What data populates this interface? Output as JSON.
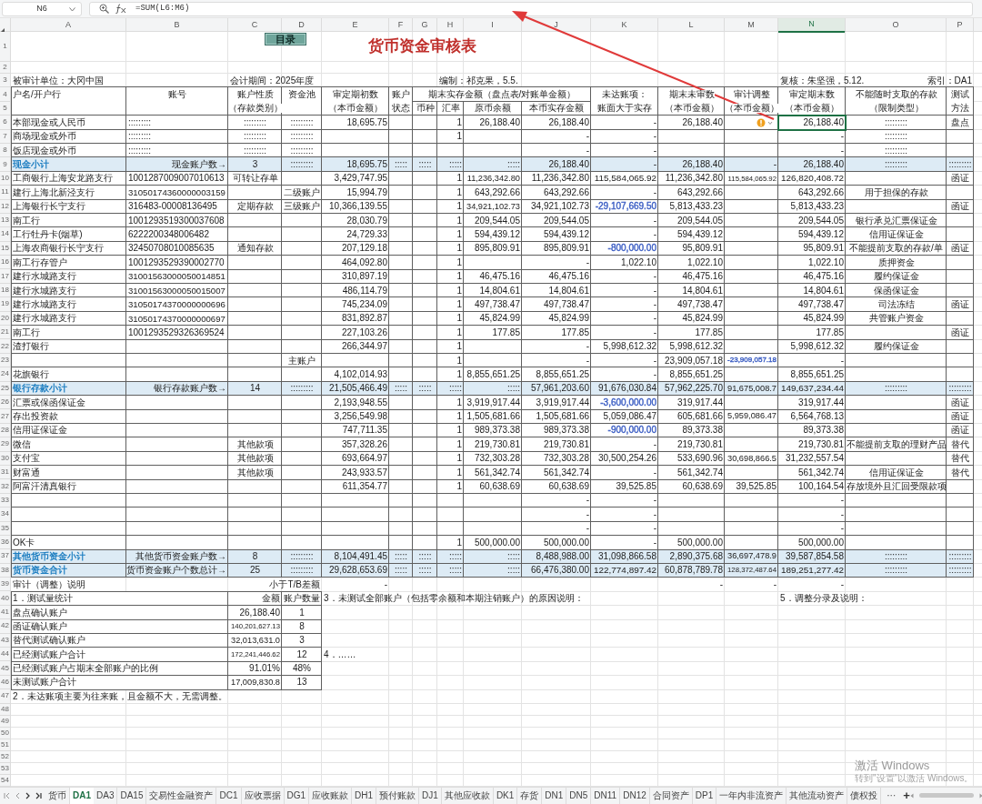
{
  "formula_bar": {
    "name_box": "N6",
    "formula": "=SUM(L6:M6)"
  },
  "columns": [
    "A",
    "B",
    "C",
    "D",
    "E",
    "F",
    "G",
    "H",
    "I",
    "J",
    "K",
    "L",
    "M",
    "N",
    "O",
    "P"
  ],
  "rows": [
    {
      "num": "1",
      "kind": "title",
      "toc_button": "目录",
      "title": "货币资金审核表"
    },
    {
      "num": "2",
      "kind": "empty"
    },
    {
      "num": "3",
      "kind": "info",
      "unit": "被审计单位：大冈中国",
      "period": "会计期间：2025年度",
      "preparer": "编制：祁克果，5.5.",
      "reviewer": "复核：朱坚强，5.12.",
      "index": "索引：DA1"
    },
    {
      "num": "4",
      "kind": "header",
      "cells": {
        "A": "户名/开户行",
        "B": "账号",
        "C": "账户性质",
        "D": "资金池",
        "E": "审定期初数",
        "F": "账户",
        "G": "期末实存金额（盘点表/对账单金额）",
        "K": "未达账项：",
        "L": "期末未审数",
        "M": "审计调整",
        "N": "审定期末数",
        "O": "不能随时支取的存款",
        "P": "测试"
      }
    },
    {
      "num": "5",
      "kind": "header",
      "cells": {
        "C": "（存款类别）",
        "E": "（本币金额）",
        "F": "状态",
        "G": "币种",
        "H": "汇率",
        "I": "原币余额",
        "J": "本币实存金额",
        "K": "账面大于实存",
        "L": "（本币金额）",
        "M": "（本币金额）",
        "N": "（本币金额）",
        "O": "（限制类型）",
        "P": "方法"
      }
    },
    {
      "num": "6",
      "kind": "row",
      "cells": {
        "A": "本部现金或人民币",
        "B": ":::::::::",
        "C": ":::::::::",
        "D": ":::::::::",
        "E": "18,695.75",
        "H": "1",
        "I": "26,188.40",
        "J": "26,188.40",
        "K": "-",
        "L": "26,188.40",
        "M": {
          "flagged": true
        },
        "N": {
          "v": "26,188.40",
          "active": true
        },
        "O": ":::::::::",
        "P": "盘点"
      }
    },
    {
      "num": "7",
      "kind": "row",
      "cells": {
        "A": "商场现金或外币",
        "B": ":::::::::",
        "C": ":::::::::",
        "D": ":::::::::",
        "H": "1",
        "J": "-",
        "K": "-",
        "N": "-",
        "O": ":::::::::"
      }
    },
    {
      "num": "8",
      "kind": "row",
      "cells": {
        "A": "饭店现金或外币",
        "B": ":::::::::",
        "C": ":::::::::",
        "D": ":::::::::",
        "J": "-",
        "K": "-",
        "N": "-",
        "O": ":::::::::"
      }
    },
    {
      "num": "9",
      "kind": "subtotal",
      "cells": {
        "A": "现金小计",
        "B": "现金账户数→",
        "C": "3",
        "D": ":::::::::",
        "E": "18,695.75",
        "F": ":::::",
        "G": ":::::",
        "H": ":::::",
        "I": ":::::",
        "J": "26,188.40",
        "K": "-",
        "L": "26,188.40",
        "M": "-",
        "N": "26,188.40",
        "O": ":::::::::",
        "P": ":::::::::"
      }
    },
    {
      "num": "10",
      "kind": "row",
      "cells": {
        "A": "工商银行上海安龙路支行",
        "B": "1001287009007010613",
        "C": "可转让存单",
        "E": "3,429,747.95",
        "H": "1",
        "I": "11,236,342.80",
        "J": "11,236,342.80",
        "K": "115,584,065.92",
        "L": "11,236,342.80",
        "M": "115,584,065.92",
        "N": "126,820,408.72",
        "P": "函证"
      }
    },
    {
      "num": "11",
      "kind": "row",
      "cells": {
        "A": "建行上海北新泾支行",
        "B": "31050174360000003159",
        "D": "二级账户",
        "E": "15,994.79",
        "H": "1",
        "I": "643,292.66",
        "J": "643,292.66",
        "K": "-",
        "L": "643,292.66",
        "N": "643,292.66",
        "O": "用于担保的存款"
      }
    },
    {
      "num": "12",
      "kind": "row",
      "cells": {
        "A": "上海银行长宁支行",
        "B": "316483-00008136495",
        "C": "定期存款",
        "D": "三级账户",
        "E": "10,366,139.55",
        "H": "1",
        "I": "34,921,102.73",
        "J": "34,921,102.73",
        "K": {
          "v": "-29,107,669.50",
          "color": "#3d5fc4"
        },
        "L": "5,813,433.23",
        "N": "5,813,433.23",
        "P": "函证"
      }
    },
    {
      "num": "13",
      "kind": "row",
      "cells": {
        "A": "南工行",
        "B": "1001293519300037608",
        "E": "28,030.79",
        "H": "1",
        "I": "209,544.05",
        "J": "209,544.05",
        "K": "-",
        "L": "209,544.05",
        "N": "209,544.05",
        "O": "银行承兑汇票保证金"
      }
    },
    {
      "num": "14",
      "kind": "row",
      "cells": {
        "A": "工行牡丹卡(烟草)",
        "B": "6222200348006482",
        "E": "24,729.33",
        "H": "1",
        "I": "594,439.12",
        "J": "594,439.12",
        "K": "-",
        "L": "594,439.12",
        "N": "594,439.12",
        "O": "信用证保证金"
      }
    },
    {
      "num": "15",
      "kind": "row",
      "cells": {
        "A": "上海农商银行长宁支行",
        "B": "32450708010085635",
        "C": "通知存款",
        "E": "207,129.18",
        "H": "1",
        "I": "895,809.91",
        "J": "895,809.91",
        "K": {
          "v": "-800,000.00",
          "color": "#3d5fc4"
        },
        "L": "95,809.91",
        "N": "95,809.91",
        "O": "不能提前支取的存款/单",
        "P": "函证"
      }
    },
    {
      "num": "16",
      "kind": "row",
      "cells": {
        "A": "南工行存管户",
        "B": "1001293529390002770",
        "E": "464,092.80",
        "H": "1",
        "J": "-",
        "K": "1,022.10",
        "L": "1,022.10",
        "N": "1,022.10",
        "O": "质押资金"
      }
    },
    {
      "num": "17",
      "kind": "row",
      "cells": {
        "A": "建行水城路支行",
        "B": "31001563000050014851",
        "E": "310,897.19",
        "H": "1",
        "I": "46,475.16",
        "J": "46,475.16",
        "K": "-",
        "L": "46,475.16",
        "N": "46,475.16",
        "O": "履约保证金"
      }
    },
    {
      "num": "18",
      "kind": "row",
      "cells": {
        "A": "建行水城路支行",
        "B": "31001563000050015007",
        "E": "486,114.79",
        "H": "1",
        "I": "14,804.61",
        "J": "14,804.61",
        "K": "-",
        "L": "14,804.61",
        "N": "14,804.61",
        "O": "保函保证金"
      }
    },
    {
      "num": "19",
      "kind": "row",
      "cells": {
        "A": "建行水城路支行",
        "B": "31050174370000000696",
        "E": "745,234.09",
        "H": "1",
        "I": "497,738.47",
        "J": "497,738.47",
        "K": "-",
        "L": "497,738.47",
        "N": "497,738.47",
        "O": "司法冻结",
        "P": "函证"
      }
    },
    {
      "num": "20",
      "kind": "row",
      "cells": {
        "A": "建行水城路支行",
        "B": "31050174370000000697",
        "E": "831,892.87",
        "H": "1",
        "I": "45,824.99",
        "J": "45,824.99",
        "K": "-",
        "L": "45,824.99",
        "N": "45,824.99",
        "O": "共管账户资金"
      }
    },
    {
      "num": "21",
      "kind": "row",
      "cells": {
        "A": "南工行",
        "B": "1001293529326369524",
        "E": "227,103.26",
        "H": "1",
        "I": "177.85",
        "J": "177.85",
        "K": "-",
        "L": "177.85",
        "N": "177.85",
        "P": "函证"
      }
    },
    {
      "num": "22",
      "kind": "row",
      "cells": {
        "A": "渣打银行",
        "E": "266,344.97",
        "H": "1",
        "J": "-",
        "K": "5,998,612.32",
        "L": "5,998,612.32",
        "N": "5,998,612.32",
        "O": "履约保证金"
      }
    },
    {
      "num": "23",
      "kind": "row",
      "cells": {
        "D": "主账户",
        "H": "1",
        "J": "-",
        "K": "-",
        "L": "23,909,057.18",
        "M": {
          "v": "-23,909,057.18",
          "color": "#3d5fc4"
        },
        "N": "-"
      }
    },
    {
      "num": "24",
      "kind": "row",
      "cells": {
        "A": "花旗银行",
        "E": "4,102,014.93",
        "H": "1",
        "I": "8,855,651.25",
        "J": "8,855,651.25",
        "K": "-",
        "L": "8,855,651.25",
        "N": "8,855,651.25"
      }
    },
    {
      "num": "25",
      "kind": "subtotal",
      "cells": {
        "A": "银行存款小计",
        "B": "银行存款账户数→",
        "C": "14",
        "D": ":::::::::",
        "E": "21,505,466.49",
        "F": ":::::",
        "G": ":::::",
        "H": ":::::",
        "I": ":::::",
        "J": "57,961,203.60",
        "K": "91,676,030.84",
        "L": "57,962,225.70",
        "M": "91,675,008.7",
        "N": "149,637,234.44",
        "O": ":::::::::",
        "P": ":::::::::"
      }
    },
    {
      "num": "26",
      "kind": "row",
      "cells": {
        "A": "汇票或保函保证金",
        "E": "2,193,948.55",
        "H": "1",
        "I": "3,919,917.44",
        "J": "3,919,917.44",
        "K": {
          "v": "-3,600,000.00",
          "color": "#3d5fc4"
        },
        "L": "319,917.44",
        "N": "319,917.44",
        "P": "函证"
      }
    },
    {
      "num": "27",
      "kind": "row",
      "cells": {
        "A": "存出投资款",
        "E": "3,256,549.98",
        "H": "1",
        "I": "1,505,681.66",
        "J": "1,505,681.66",
        "K": "5,059,086.47",
        "L": "605,681.66",
        "M": "5,959,086.47",
        "N": "6,564,768.13",
        "P": "函证"
      }
    },
    {
      "num": "28",
      "kind": "row",
      "cells": {
        "A": "信用证保证金",
        "E": "747,711.35",
        "H": "1",
        "I": "989,373.38",
        "J": "989,373.38",
        "K": {
          "v": "-900,000.00",
          "color": "#3d5fc4"
        },
        "L": "89,373.38",
        "N": "89,373.38",
        "P": "函证"
      }
    },
    {
      "num": "29",
      "kind": "row",
      "cells": {
        "A": "微信",
        "C": "其他款项",
        "E": "357,328.26",
        "H": "1",
        "I": "219,730.81",
        "J": "219,730.81",
        "K": "-",
        "L": "219,730.81",
        "N": "219,730.81",
        "O": "不能提前支取的理财产品",
        "P": "替代"
      }
    },
    {
      "num": "30",
      "kind": "row",
      "cells": {
        "A": "支付宝",
        "C": "其他款项",
        "E": "693,664.97",
        "H": "1",
        "I": "732,303.28",
        "J": "732,303.28",
        "K": "30,500,254.26",
        "L": "533,690.96",
        "M": "30,698,866.5",
        "N": "31,232,557.54",
        "P": "替代"
      }
    },
    {
      "num": "31",
      "kind": "row",
      "cells": {
        "A": "财富通",
        "C": "其他款项",
        "E": "243,933.57",
        "H": "1",
        "I": "561,342.74",
        "J": "561,342.74",
        "K": "-",
        "L": "561,342.74",
        "N": "561,342.74",
        "O": "信用证保证金",
        "P": "替代"
      }
    },
    {
      "num": "32",
      "kind": "row",
      "cells": {
        "A": "阿富汗清真银行",
        "E": "611,354.77",
        "H": "1",
        "I": "60,638.69",
        "J": "60,638.69",
        "K": "39,525.85",
        "L": "60,638.69",
        "M": "39,525.85",
        "N": "100,164.54",
        "O": "存放境外且汇回受限款项"
      }
    },
    {
      "num": "33",
      "kind": "row",
      "cells": {
        "J": "-",
        "K": "-",
        "N": "-"
      }
    },
    {
      "num": "34",
      "kind": "row",
      "cells": {
        "J": "-",
        "K": "-",
        "N": "-"
      }
    },
    {
      "num": "35",
      "kind": "row",
      "cells": {
        "J": "-",
        "K": "-",
        "N": "-"
      }
    },
    {
      "num": "36",
      "kind": "row",
      "cells": {
        "A": "OK卡",
        "H": "1",
        "I": "500,000.00",
        "J": "500,000.00",
        "K": "-",
        "L": "500,000.00",
        "N": "500,000.00"
      }
    },
    {
      "num": "37",
      "kind": "subtotal",
      "cells": {
        "A": "其他货币资金小计",
        "B": "其他货币资金账户数→",
        "C": "8",
        "D": ":::::::::",
        "E": "8,104,491.45",
        "F": ":::::",
        "G": ":::::",
        "H": ":::::",
        "I": ":::::",
        "J": "8,488,988.00",
        "K": "31,098,866.58",
        "L": "2,890,375.68",
        "M": "36,697,478.9",
        "N": "39,587,854.58",
        "O": ":::::::::",
        "P": ":::::::::"
      }
    },
    {
      "num": "38",
      "kind": "subtotal",
      "cells": {
        "A": "货币资金合计",
        "B": "货币资金账户个数总计→",
        "C": "25",
        "D": ":::::::::",
        "E": "29,628,653.69",
        "F": ":::::",
        "G": ":::::",
        "H": ":::::",
        "I": ":::::",
        "J": "66,476,380.00",
        "K": "122,774,897.42",
        "L": "60,878,789.78",
        "M": "128,372,487.64",
        "N": "189,251,277.42",
        "O": ":::::::::",
        "P": ":::::::::"
      }
    },
    {
      "num": "39",
      "kind": "difference",
      "cells": {
        "A": "审计（调整）说明",
        "D": "小于T/B差额",
        "E": "-",
        "L": "-",
        "M": "-",
        "N": "-"
      }
    },
    {
      "num": "40",
      "kind": "stats",
      "cells": {
        "A": "1．测试量统计",
        "C": "金额",
        "D": "账户数量",
        "E": "3．未测试全部账户（包括零余额和本期注销账户）的原因说明：",
        "N": "5．调整分录及说明："
      }
    },
    {
      "num": "41",
      "kind": "stats",
      "cells": {
        "A": "盘点确认账户",
        "C": "26,188.40",
        "D": "1"
      }
    },
    {
      "num": "42",
      "kind": "stats",
      "cells": {
        "A": "函证确认账户",
        "C": "140,201,627.13",
        "D": "8"
      }
    },
    {
      "num": "43",
      "kind": "stats",
      "cells": {
        "A": "替代测试确认账户",
        "C": "32,013,631.0",
        "D": "3"
      }
    },
    {
      "num": "44",
      "kind": "stats",
      "cells": {
        "A": "已经测试账户合计",
        "C": "172,241,446.62",
        "D": "12",
        "E": "4．……"
      }
    },
    {
      "num": "45",
      "kind": "stats",
      "cells": {
        "A": "已经测试账户占期末全部账户的比例",
        "C": "91.01%",
        "D": "48%"
      }
    },
    {
      "num": "46",
      "kind": "stats",
      "cells": {
        "A": "未测试账户合计",
        "C": "17,009,830.8",
        "D": "13"
      }
    },
    {
      "num": "47",
      "kind": "note",
      "cells": {
        "A": "2．未达账项主要为往来账，且金额不大，无需调整。"
      }
    },
    {
      "num": "48",
      "kind": "empty"
    },
    {
      "num": "49",
      "kind": "empty"
    },
    {
      "num": "50",
      "kind": "empty"
    },
    {
      "num": "51",
      "kind": "empty"
    },
    {
      "num": "52",
      "kind": "empty"
    },
    {
      "num": "53",
      "kind": "empty"
    },
    {
      "num": "54",
      "kind": "empty"
    }
  ],
  "sheet_tabs": [
    {
      "label": "货币",
      "selected": false
    },
    {
      "label": "DA1",
      "selected": true
    },
    {
      "label": "DA3",
      "selected": false
    },
    {
      "label": "DA15",
      "selected": false
    },
    {
      "label": "交易性金融资产",
      "selected": false
    },
    {
      "label": "DC1",
      "selected": false
    },
    {
      "label": "应收票据",
      "selected": false
    },
    {
      "label": "DG1",
      "selected": false
    },
    {
      "label": "应收账款",
      "selected": false
    },
    {
      "label": "DH1",
      "selected": false
    },
    {
      "label": "预付账款",
      "selected": false
    },
    {
      "label": "DJ1",
      "selected": false
    },
    {
      "label": "其他应收款",
      "selected": false
    },
    {
      "label": "DK1",
      "selected": false
    },
    {
      "label": "存货",
      "selected": false
    },
    {
      "label": "DN1",
      "selected": false
    },
    {
      "label": "DN5",
      "selected": false
    },
    {
      "label": "DN11",
      "selected": false
    },
    {
      "label": "DN12",
      "selected": false
    },
    {
      "label": "合同资产",
      "selected": false
    },
    {
      "label": "DP1",
      "selected": false
    },
    {
      "label": "一年内非流资产",
      "selected": false
    },
    {
      "label": "其他流动资产",
      "selected": false
    },
    {
      "label": "债权投",
      "selected": false
    }
  ],
  "tabs_more": "···",
  "add_sheet": "+",
  "windows_notice": {
    "title": "激活 Windows",
    "text": "转到\"设置\"以激活 Windows。"
  }
}
